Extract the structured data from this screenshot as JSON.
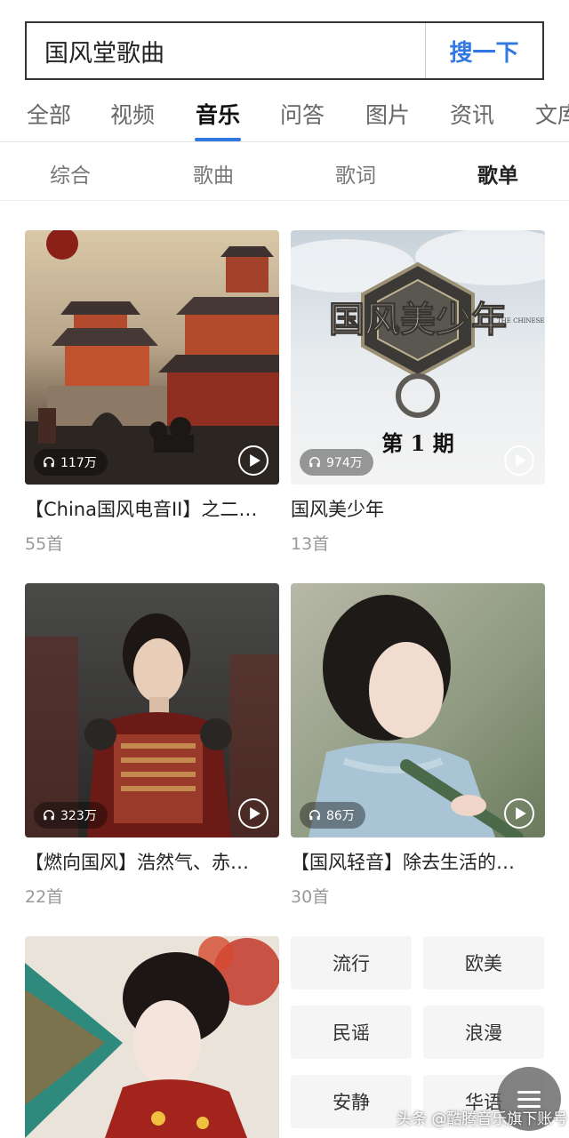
{
  "search": {
    "query": "国风堂歌曲",
    "button_label": "搜一下"
  },
  "main_tabs": [
    {
      "label": "全部"
    },
    {
      "label": "视频"
    },
    {
      "label": "音乐"
    },
    {
      "label": "问答"
    },
    {
      "label": "图片"
    },
    {
      "label": "资讯"
    },
    {
      "label": "文库"
    }
  ],
  "active_main_tab": "音乐",
  "sub_tabs": [
    {
      "label": "综合"
    },
    {
      "label": "歌曲"
    },
    {
      "label": "歌词"
    },
    {
      "label": "歌单"
    }
  ],
  "active_sub_tab": "歌单",
  "playlists": [
    {
      "title": "【China国风电音II】之二…",
      "play_count": "117万",
      "track_count": "55首"
    },
    {
      "title": "国风美少年",
      "play_count": "974万",
      "track_count": "13首",
      "cover_text": "国风美少年",
      "cover_sub": "第 1 期",
      "cover_en": "THE CHINESE YOUTH"
    },
    {
      "title": "【燃向国风】浩然气、赤…",
      "play_count": "323万",
      "track_count": "22首"
    },
    {
      "title": "【国风轻音】除去生活的…",
      "play_count": "86万",
      "track_count": "30首"
    }
  ],
  "genre_tags": [
    {
      "label": "流行"
    },
    {
      "label": "欧美"
    },
    {
      "label": "民谣"
    },
    {
      "label": "浪漫"
    },
    {
      "label": "安静"
    },
    {
      "label": "华语"
    }
  ],
  "watermark": "头条 @酷腾音乐旗下账号",
  "colors": {
    "accent": "#3178e0",
    "muted_text": "#999999",
    "tag_bg": "#f5f5f5"
  }
}
